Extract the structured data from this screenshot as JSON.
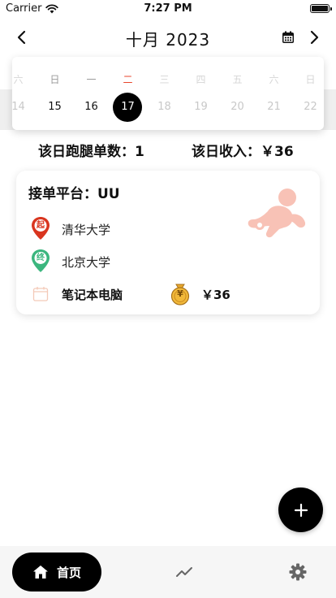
{
  "status_bar": {
    "carrier": "Carrier",
    "time": "7:27 PM",
    "battery_level": 1.0
  },
  "header": {
    "title": "十月 2023",
    "prev_icon": "chevron-left-icon",
    "calendar_icon": "calendar-icon",
    "next_icon": "chevron-right-icon"
  },
  "calendar": {
    "weekdays": [
      "六",
      "日",
      "一",
      "二",
      "三",
      "四",
      "五",
      "六",
      "日"
    ],
    "dates": [
      "14",
      "15",
      "16",
      "17",
      "18",
      "19",
      "20",
      "21",
      "22"
    ],
    "selected_index": 3
  },
  "summary": {
    "orders": "该日跑腿单数：1",
    "income": "该日收入：￥36"
  },
  "order": {
    "platform": "接单平台：UU",
    "start_badge": "起",
    "start": "清华大学",
    "end_badge": "终",
    "end": "北京大学",
    "item": "笔记本电脑",
    "coin_symbol": "¥",
    "price": "￥36"
  },
  "tabbar": {
    "home_label": "首页",
    "home_icon": "home-icon",
    "stats_icon": "trend-icon",
    "settings_icon": "gear-icon"
  },
  "colors": {
    "accent_red": "#e8462d",
    "start_pin": "#d9351f",
    "end_pin": "#3bb67e",
    "logo": "#f8c2b6",
    "coin": "#e8a82e"
  }
}
